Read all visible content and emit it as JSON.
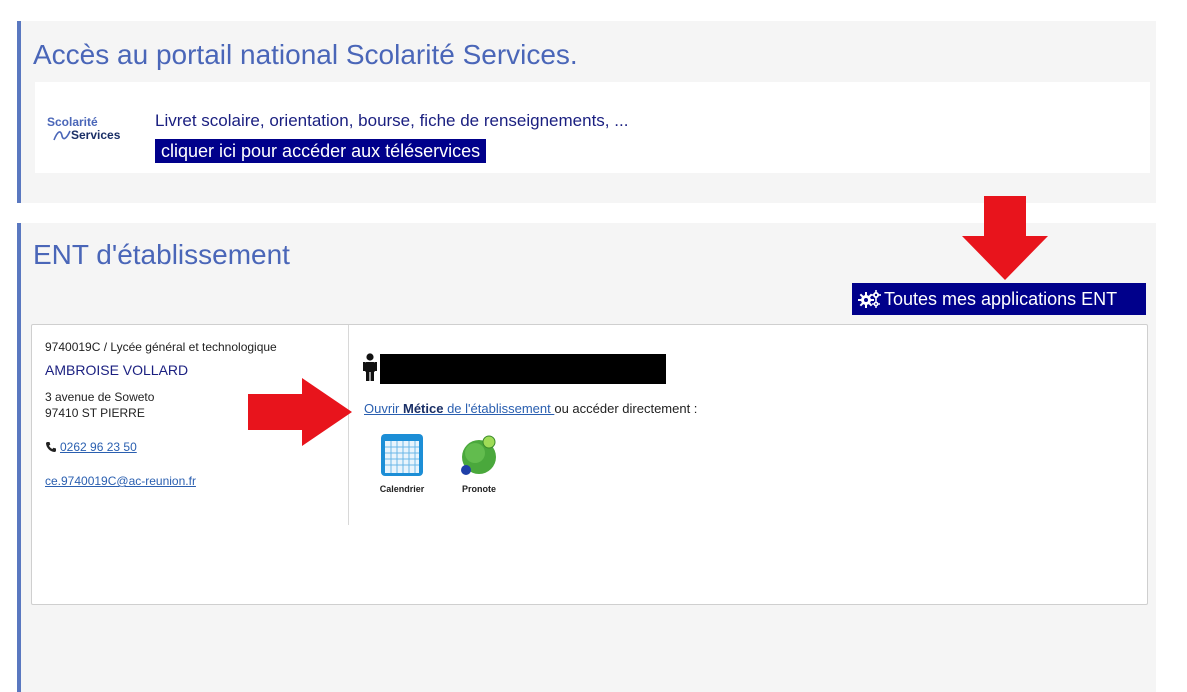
{
  "scolarite": {
    "title": "Accès au portail national Scolarité Services.",
    "logo_line1": "Scolarité",
    "logo_line2": "Services",
    "description": "Livret scolaire, orientation, bourse, fiche de renseignements, ...",
    "cta_label": "cliquer ici pour accéder aux téléservices"
  },
  "ent": {
    "title": "ENT d'établissement",
    "all_apps_label": "Toutes mes applications ENT",
    "establishment": {
      "uai": "9740019C / Lycée général et technologique",
      "name": "AMBROISE VOLLARD",
      "address_line1": "3 avenue de Soweto",
      "address_line2": "97410 ST PIERRE",
      "phone": "0262 96 23 50",
      "email": "ce.9740019C@ac-reunion.fr"
    },
    "open_link_prefix": "Ouvrir ",
    "open_link_bold": "Métice",
    "open_link_suffix": " de l'établissement ",
    "open_line_tail": "ou accéder directement  :",
    "apps": [
      {
        "label": "Calendrier",
        "icon": "calendar-icon"
      },
      {
        "label": "Pronote",
        "icon": "pronote-icon"
      }
    ]
  },
  "colors": {
    "accent": "#4a66b8",
    "button_bg": "#00008b",
    "arrow": "#e8141c"
  }
}
